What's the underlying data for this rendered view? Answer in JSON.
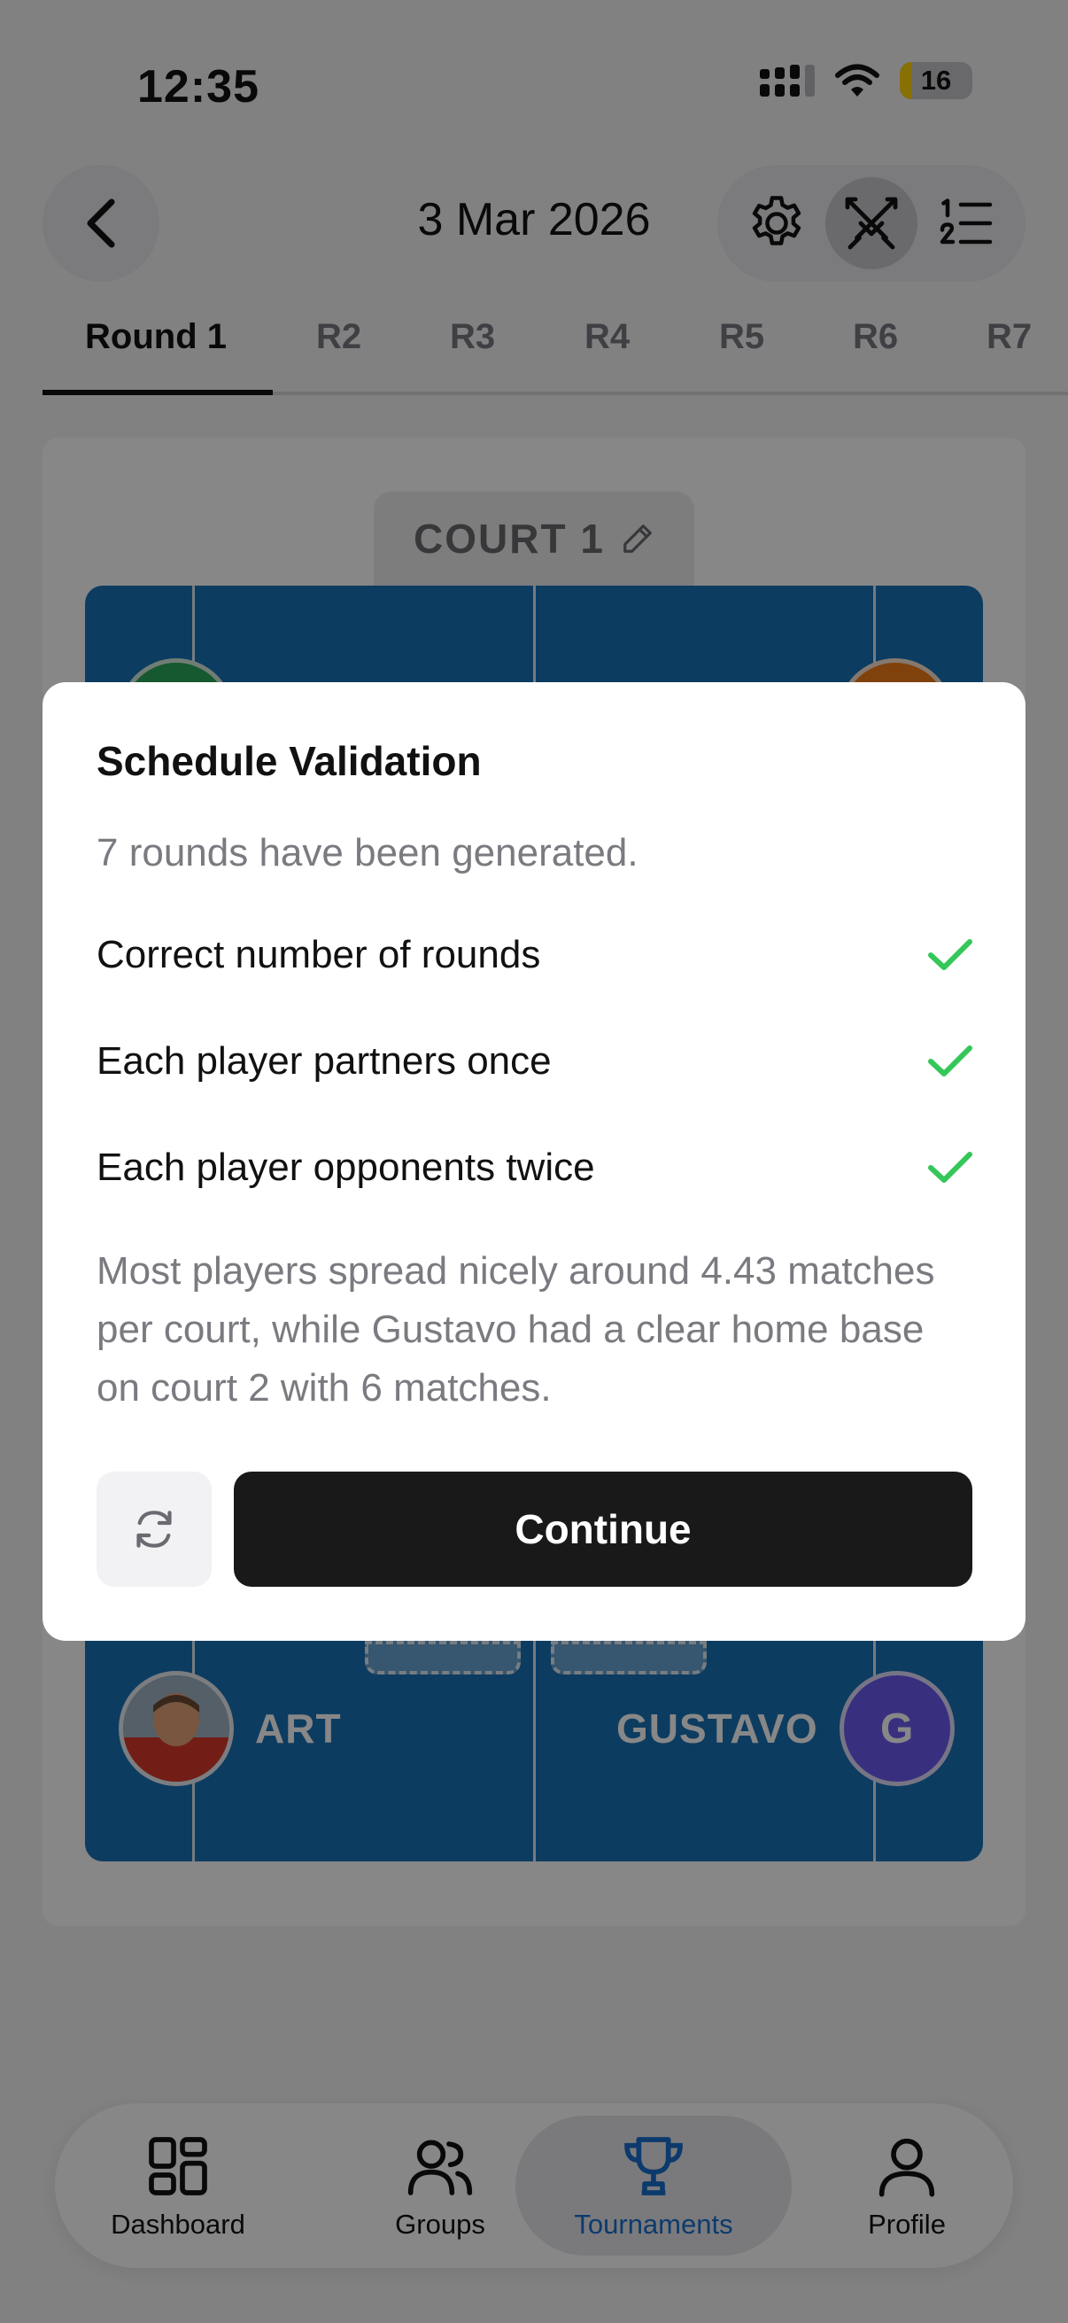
{
  "status_bar": {
    "time": "12:35",
    "battery_percent": 16,
    "battery_label": "16"
  },
  "header": {
    "date": "3 Mar 2026",
    "back_icon": "chevron-left-icon",
    "actions": [
      {
        "icon": "gear-icon",
        "active": false
      },
      {
        "icon": "crossed-swords-icon",
        "active": true
      },
      {
        "icon": "numbered-list-icon",
        "active": false
      }
    ]
  },
  "rounds": {
    "active_index": 0,
    "tabs": [
      "Round 1",
      "R2",
      "R3",
      "R4",
      "R5",
      "R6",
      "R7"
    ]
  },
  "court": {
    "label": "COURT 1",
    "edit_icon": "pencil-icon",
    "players_bottom": [
      {
        "name": "ART",
        "avatar": "photo"
      },
      {
        "name": "GUSTAVO",
        "initial": "G"
      }
    ],
    "colors": {
      "court": "#1a72b8",
      "avatar_top_left": "#2aa65a",
      "avatar_top_right": "#f07d1a",
      "avatar_gustavo": "#6a5cf0"
    }
  },
  "dialog": {
    "title": "Schedule Validation",
    "subtitle": "7 rounds have been generated.",
    "checks": [
      {
        "label": "Correct number of rounds",
        "passed": true
      },
      {
        "label": "Each player partners once",
        "passed": true
      },
      {
        "label": "Each player opponents twice",
        "passed": true
      }
    ],
    "summary": "Most players spread nicely around 4.43 matches per court, while Gustavo had a clear home base on court 2 with 6 matches.",
    "regenerate_icon": "refresh-icon",
    "continue_label": "Continue",
    "check_color": "#34c759"
  },
  "bottom_nav": {
    "active_index": 2,
    "items": [
      {
        "label": "Dashboard",
        "icon": "dashboard-grid-icon"
      },
      {
        "label": "Groups",
        "icon": "users-icon"
      },
      {
        "label": "Tournaments",
        "icon": "trophy-icon"
      },
      {
        "label": "Profile",
        "icon": "user-icon"
      }
    ],
    "active_color": "#1a6fcf"
  }
}
